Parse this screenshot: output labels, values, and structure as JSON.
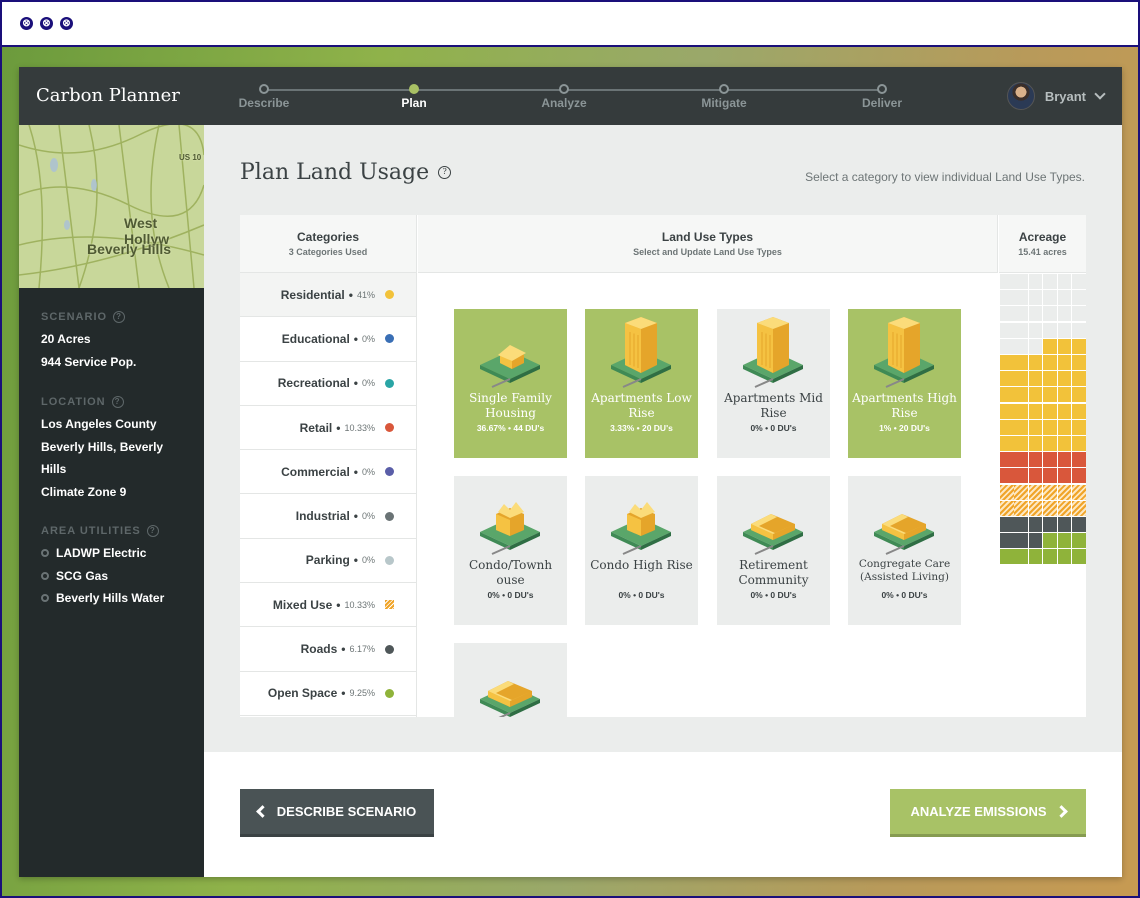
{
  "window": {
    "buttons": [
      "⊗",
      "⊗",
      "⊗"
    ]
  },
  "app": {
    "brand": "Carbon Planner"
  },
  "stepper": {
    "steps": [
      {
        "label": "Describe",
        "state": "done"
      },
      {
        "label": "Plan",
        "state": "active"
      },
      {
        "label": "Analyze",
        "state": "todo"
      },
      {
        "label": "Mitigate",
        "state": "todo"
      },
      {
        "label": "Deliver",
        "state": "todo"
      }
    ]
  },
  "user": {
    "name": "Bryant"
  },
  "map": {
    "labels": [
      "West Hollyw",
      "Beverly Hills",
      "US 10"
    ]
  },
  "sidebar": {
    "scenario_head": "SCENARIO",
    "scenario": [
      "20 Acres",
      "944 Service Pop."
    ],
    "location_head": "LOCATION",
    "location": [
      "Los Angeles County",
      "Beverly Hills, Beverly",
      "Hills",
      "Climate Zone 9"
    ],
    "utilities_head": "AREA UTILITIES",
    "utilities": [
      "LADWP Electric",
      "SCG Gas",
      "Beverly Hills Water"
    ]
  },
  "page": {
    "title": "Plan Land Usage",
    "hint": "Select a category to view individual Land Use Types."
  },
  "columns": {
    "categories": {
      "title": "Categories",
      "sub": "3 Categories Used"
    },
    "types": {
      "title": "Land Use Types",
      "sub": "Select and Update Land Use Types"
    },
    "acreage": {
      "title": "Acreage",
      "sub": "15.41 acres"
    }
  },
  "categories": [
    {
      "name": "Residential",
      "pct": "41%",
      "color": "#f2c23a",
      "selected": true
    },
    {
      "name": "Educational",
      "pct": "0%",
      "color": "#3a6fb5"
    },
    {
      "name": "Recreational",
      "pct": "0%",
      "color": "#2aa5a5"
    },
    {
      "name": "Retail",
      "pct": "10.33%",
      "color": "#d9573b"
    },
    {
      "name": "Commercial",
      "pct": "0%",
      "color": "#5a5ea8"
    },
    {
      "name": "Industrial",
      "pct": "0%",
      "color": "#6a7375"
    },
    {
      "name": "Parking",
      "pct": "0%",
      "color": "#b8c7ca"
    },
    {
      "name": "Mixed Use",
      "pct": "10.33%",
      "color": "#f0a428",
      "hatch": true
    },
    {
      "name": "Roads",
      "pct": "6.17%",
      "color": "#4f5759"
    },
    {
      "name": "Open Space",
      "pct": "9.25%",
      "color": "#8fb33a"
    }
  ],
  "types": [
    {
      "name": "Single Family Housing",
      "stats": "36.67% • 44 DU's",
      "on": true,
      "icon": "house-icon"
    },
    {
      "name": "Apartments Low Rise",
      "stats": "3.33% • 20 DU's",
      "on": true,
      "icon": "tower-icon"
    },
    {
      "name": "Apartments Mid Rise",
      "stats": "0% • 0 DU's",
      "on": false,
      "icon": "tower-icon"
    },
    {
      "name": "Apartments High Rise",
      "stats": "1% • 20 DU's",
      "on": true,
      "icon": "tower-icon"
    },
    {
      "name": "Condo/Townh ouse",
      "stats": "0% • 0 DU's",
      "on": false,
      "icon": "townhouse-icon"
    },
    {
      "name": "Condo High Rise",
      "stats": "0% • 0 DU's",
      "on": false,
      "icon": "townhouse-icon"
    },
    {
      "name": "Retirement Community",
      "stats": "0% • 0 DU's",
      "on": false,
      "icon": "lshape-icon"
    },
    {
      "name": "Congregate Care (Assisted Living)",
      "stats": "0% • 0 DU's",
      "on": false,
      "icon": "lshape-icon",
      "small": true
    },
    {
      "name": "",
      "stats": "",
      "on": false,
      "icon": "lshape-icon"
    }
  ],
  "acreage_grid": {
    "columns": 6,
    "cells": [
      "empty:27",
      "residential:39",
      "retail:12",
      "mixed:12",
      "roads:9",
      "open:9"
    ],
    "colors": {
      "empty": "#ebedec",
      "residential": "#f2c23a",
      "retail": "#d9573b",
      "mixed": "#f0a428",
      "roads": "#4f5759",
      "open": "#8fb33a"
    }
  },
  "footer": {
    "back": "DESCRIBE SCENARIO",
    "next": "ANALYZE EMISSIONS"
  }
}
